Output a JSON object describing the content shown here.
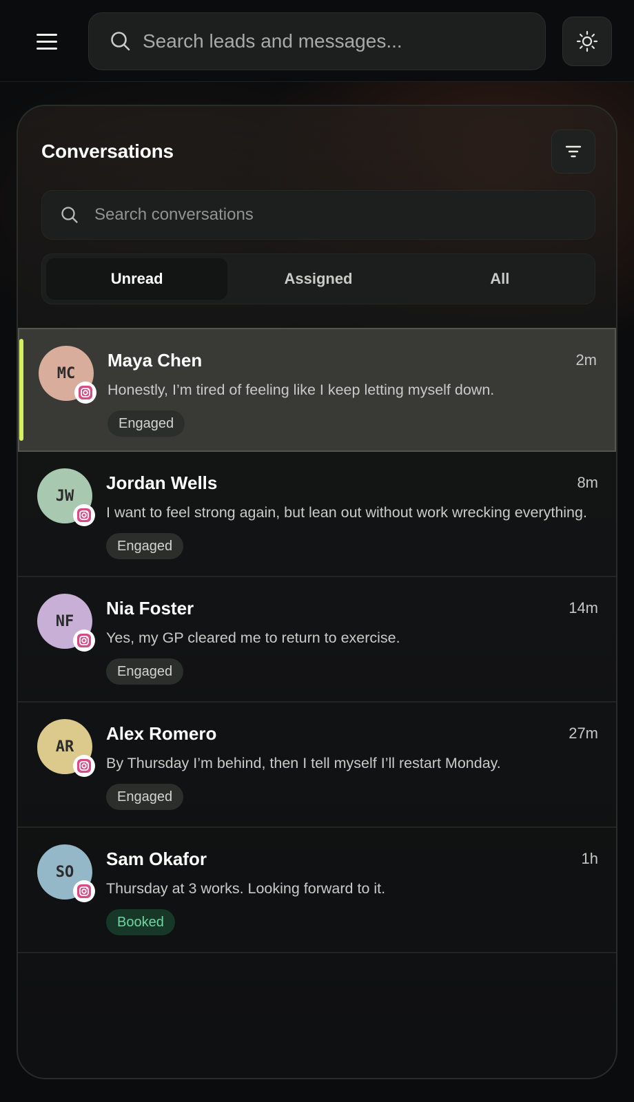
{
  "topbar": {
    "search_placeholder": "Search leads and messages..."
  },
  "panel": {
    "title": "Conversations",
    "search_placeholder": "Search conversations",
    "tabs": [
      {
        "label": "Unread",
        "active": true
      },
      {
        "label": "Assigned",
        "active": false
      },
      {
        "label": "All",
        "active": false
      }
    ]
  },
  "conversations": [
    {
      "initials": "MC",
      "name": "Maya Chen",
      "time": "2m",
      "preview": "Honestly, I’m tired of feeling like I keep letting myself down.",
      "status": "Engaged",
      "avatar_color": "#d9ad9c",
      "channel_icon": "instagram-icon",
      "selected": true
    },
    {
      "initials": "JW",
      "name": "Jordan Wells",
      "time": "8m",
      "preview": "I want to feel strong again, but lean out without work wrecking everything.",
      "status": "Engaged",
      "avatar_color": "#a9c8b0",
      "channel_icon": "instagram-icon",
      "selected": false
    },
    {
      "initials": "NF",
      "name": "Nia Foster",
      "time": "14m",
      "preview": "Yes, my GP cleared me to return to exercise.",
      "status": "Engaged",
      "avatar_color": "#c8afd6",
      "channel_icon": "instagram-icon",
      "selected": false
    },
    {
      "initials": "AR",
      "name": "Alex Romero",
      "time": "27m",
      "preview": "By Thursday I’m behind, then I tell myself I’ll restart Monday.",
      "status": "Engaged",
      "avatar_color": "#dcc98c",
      "channel_icon": "instagram-icon",
      "selected": false
    },
    {
      "initials": "SO",
      "name": "Sam Okafor",
      "time": "1h",
      "preview": "Thursday at 3 works. Looking forward to it.",
      "status": "Booked",
      "avatar_color": "#94b8c8",
      "channel_icon": "instagram-icon",
      "selected": false
    }
  ],
  "colors": {
    "accent": "#d4f25a",
    "booked_text": "#6fd6a0",
    "instagram": "#d64b84"
  }
}
